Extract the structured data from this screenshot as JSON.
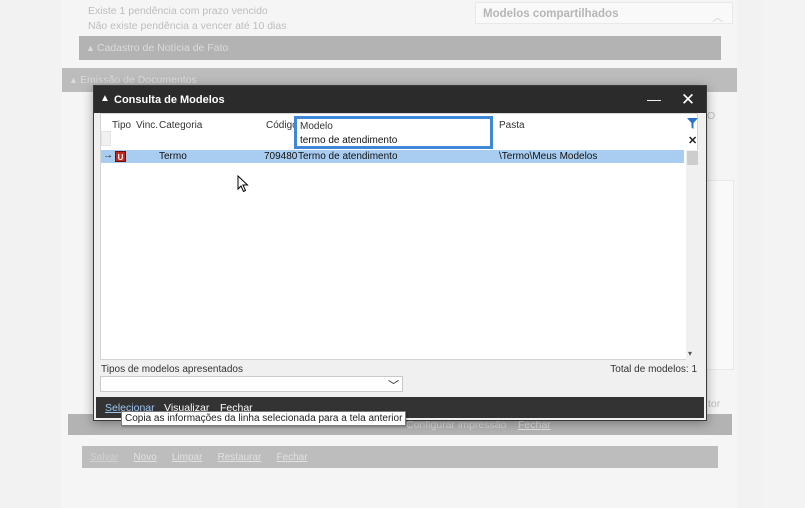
{
  "background": {
    "pending_line1": "Existe 1 pendência com prazo vencido",
    "pending_line2": "Não existe pendência a vencer até 10 dias",
    "shared_models_title": "Modelos compartilhados",
    "bar_cadastro": "Cadastro de Notícia de Fato",
    "bar_emissao": "Emissão de Documentos",
    "bg_button_bar": {
      "salvar": "Salvar",
      "novo": "Novo",
      "limpar": "Limpar",
      "restaurar": "Restaurar",
      "fechar": "Fechar"
    },
    "bg_fechar2": "Fechar",
    "bg_configurar": "Configurar impressão",
    "bg_tor": "tor",
    "bg_o": "O"
  },
  "dialog": {
    "title": "Consulta de Modelos",
    "columns": {
      "tipo": "Tipo",
      "vinc": "Vinc.",
      "categoria": "Categoria",
      "codigo": "Código",
      "modelo": "Modelo",
      "pasta": "Pasta"
    },
    "modelo_filter_value": "termo de atendimento",
    "rows": [
      {
        "type_icon_letter": "U",
        "categoria": "Termo",
        "codigo": "709480",
        "modelo": "Termo de atendimento",
        "pasta": "\\Termo\\Meus Modelos"
      }
    ],
    "types_label": "Tipos de modelos apresentados",
    "total_label": "Total de modelos: 1",
    "actions": {
      "selecionar": "Selecionar",
      "visualizar": "Visualizar",
      "fechar": "Fechar"
    },
    "tooltip": "Copia as informações da linha selecionada para a tela anterior"
  },
  "icons": {
    "app": "app-triangle-icon",
    "filter": "filter-funnel-icon",
    "clear": "clear-x-icon",
    "row_pointer": "row-arrow-icon",
    "type": "template-type-icon"
  },
  "colors": {
    "titlebar": "#2b2b2b",
    "selected_row": "#a9cdf0",
    "focus_border": "#3f88d8",
    "type_icon": "#c4271b",
    "action_link": "#9fc7f2"
  }
}
